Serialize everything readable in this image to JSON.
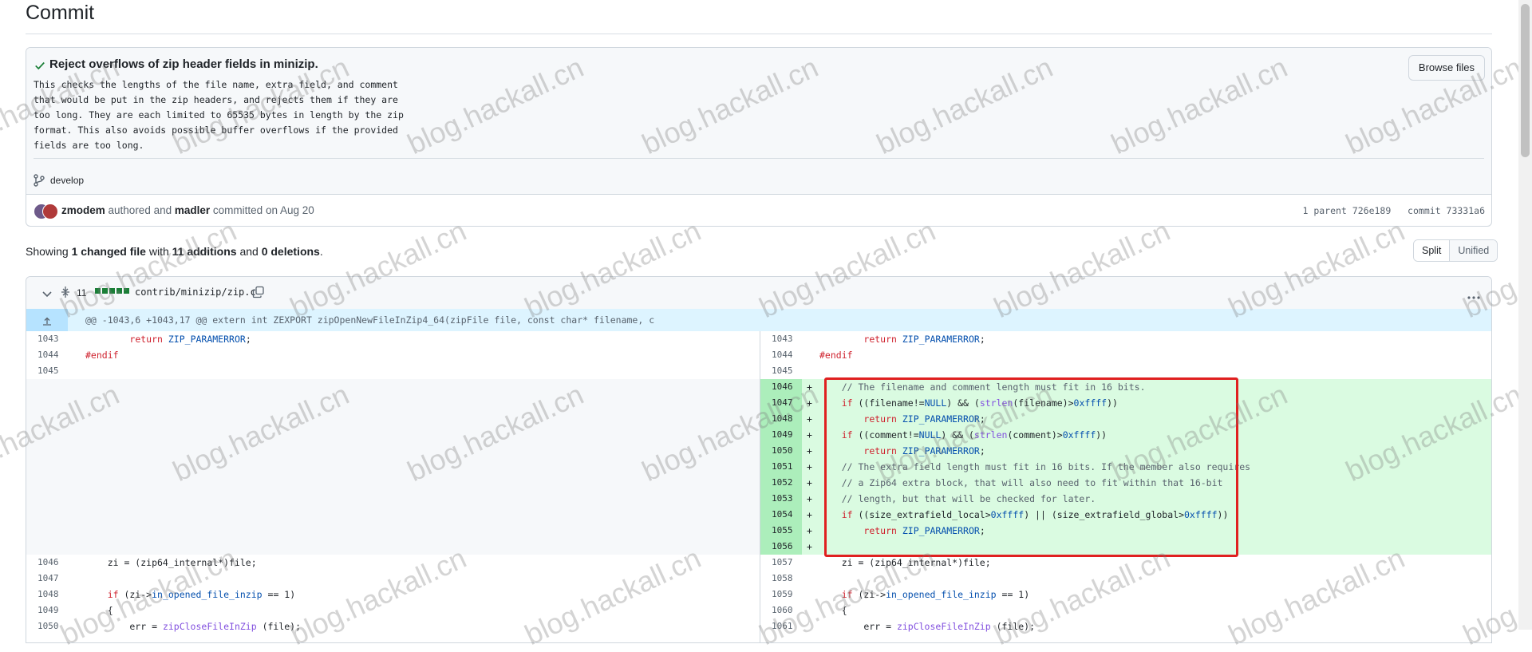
{
  "page": {
    "title": "Commit"
  },
  "commit": {
    "title": "Reject overflows of zip header fields in minizip.",
    "body": "This checks the lengths of the file name, extra field, and comment\nthat would be put in the zip headers, and rejects them if they are\ntoo long. They are each limited to 65535 bytes in length by the zip\nformat. This also avoids possible buffer overflows if the provided\nfields are too long.",
    "browse_label": "Browse files",
    "branch": "develop",
    "author": "zmodem",
    "authored_text": "authored and",
    "committer": "madler",
    "committed_text": "committed on Aug 20",
    "parent_label": "1 parent",
    "parent_sha": "726e189",
    "commit_label": "commit",
    "commit_sha": "73331a6"
  },
  "summary": {
    "prefix": "Showing",
    "changed": "1 changed file",
    "with": "with",
    "additions": "11 additions",
    "and": "and",
    "deletions": "0 deletions",
    "end": "."
  },
  "view_toggle": {
    "split": "Split",
    "unified": "Unified"
  },
  "file": {
    "change_count": "11",
    "path": "contrib/minizip/zip.c",
    "hunk": "@@ -1043,6 +1043,17 @@ extern int ZEXPORT zipOpenNewFileInZip4_64(zipFile file, const char* filename, c"
  },
  "diff": {
    "context_before": [
      {
        "left_num": "1043",
        "right_num": "1043",
        "code": "        return ZIP_PARAMERROR;"
      },
      {
        "left_num": "1044",
        "right_num": "1044",
        "code": "#endif"
      },
      {
        "left_num": "1045",
        "right_num": "1045",
        "code": ""
      }
    ],
    "additions": [
      {
        "num": "1046",
        "sign": "+",
        "code": "    // The filename and comment length must fit in 16 bits."
      },
      {
        "num": "1047",
        "sign": "+",
        "code": "    if ((filename!=NULL) && (strlen(filename)>0xffff))"
      },
      {
        "num": "1048",
        "sign": "+",
        "code": "        return ZIP_PARAMERROR;"
      },
      {
        "num": "1049",
        "sign": "+",
        "code": "    if ((comment!=NULL) && (strlen(comment)>0xffff))"
      },
      {
        "num": "1050",
        "sign": "+",
        "code": "        return ZIP_PARAMERROR;"
      },
      {
        "num": "1051",
        "sign": "+",
        "code": "    // The extra field length must fit in 16 bits. If the member also requires"
      },
      {
        "num": "1052",
        "sign": "+",
        "code": "    // a Zip64 extra block, that will also need to fit within that 16-bit"
      },
      {
        "num": "1053",
        "sign": "+",
        "code": "    // length, but that will be checked for later."
      },
      {
        "num": "1054",
        "sign": "+",
        "code": "    if ((size_extrafield_local>0xffff) || (size_extrafield_global>0xffff))"
      },
      {
        "num": "1055",
        "sign": "+",
        "code": "        return ZIP_PARAMERROR;"
      },
      {
        "num": "1056",
        "sign": "+",
        "code": ""
      }
    ],
    "context_after": [
      {
        "left_num": "1046",
        "right_num": "1057",
        "code": "    zi = (zip64_internal*)file;"
      },
      {
        "left_num": "1047",
        "right_num": "1058",
        "code": ""
      },
      {
        "left_num": "1048",
        "right_num": "1059",
        "code": "    if (zi->in_opened_file_inzip == 1)"
      },
      {
        "left_num": "1049",
        "right_num": "1060",
        "code": "    {"
      },
      {
        "left_num": "1050",
        "right_num": "1061",
        "code": "        err = zipCloseFileInZip (file);"
      }
    ]
  },
  "watermark": "blog.hackall.cn",
  "colors": {
    "add_bg": "#dafbe1",
    "add_num_bg": "#aceebb",
    "hunk_bg": "#ddf4ff",
    "highlight": "#e02020"
  }
}
